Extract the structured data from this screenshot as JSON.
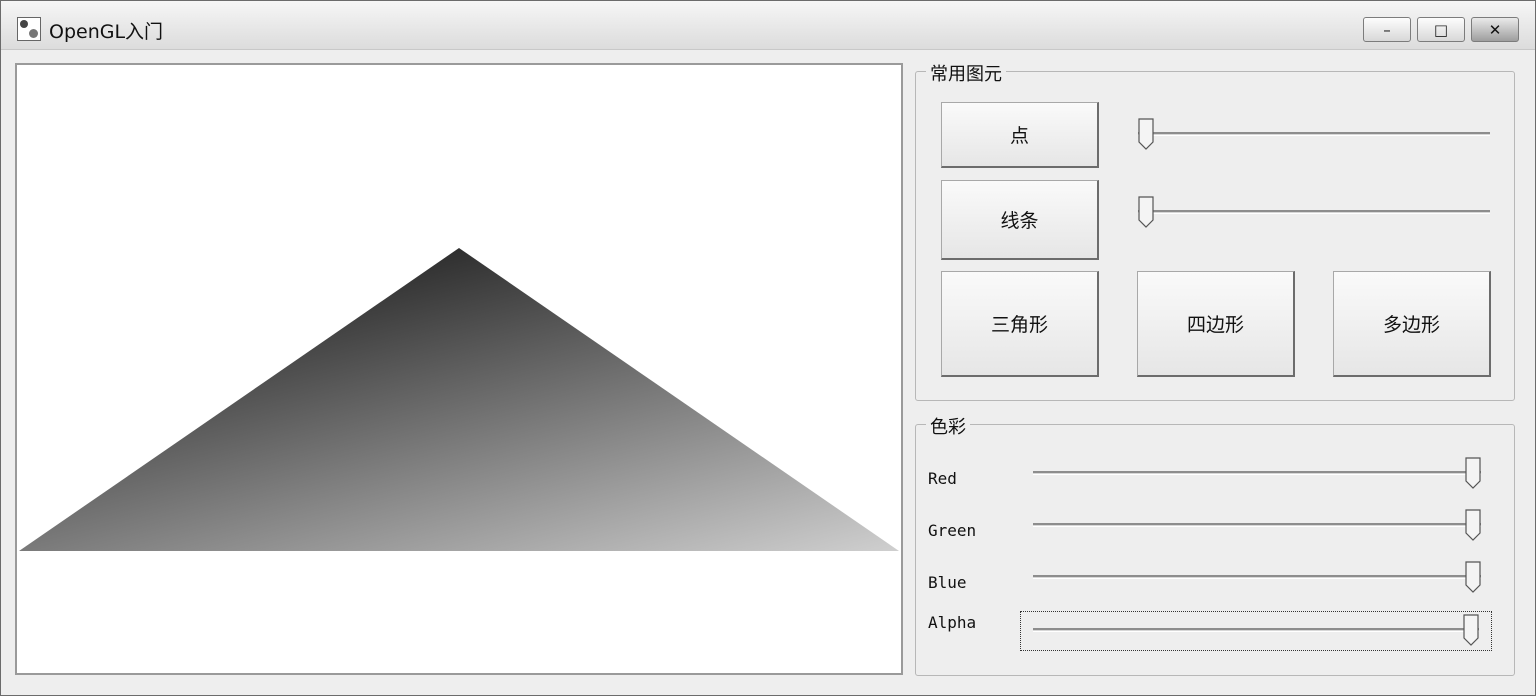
{
  "window": {
    "title": "OpenGL入门",
    "minimize_glyph": "–",
    "maximize_glyph": "□",
    "close_glyph": "✕"
  },
  "primitives": {
    "legend": "常用图元",
    "point_button": "点",
    "line_button": "线条",
    "triangle_button": "三角形",
    "quad_button": "四边形",
    "polygon_button": "多边形",
    "point_size_slider_value": 0,
    "line_width_slider_value": 0
  },
  "color": {
    "legend": "色彩",
    "red_label": "Red",
    "green_label": "Green",
    "blue_label": "Blue",
    "alpha_label": "Alpha",
    "red_value": 1.0,
    "green_value": 1.0,
    "blue_value": 1.0,
    "alpha_value": 1.0
  },
  "colors": {
    "triangle_dark": "#2e2e2e",
    "triangle_light": "#cfcfcf"
  }
}
